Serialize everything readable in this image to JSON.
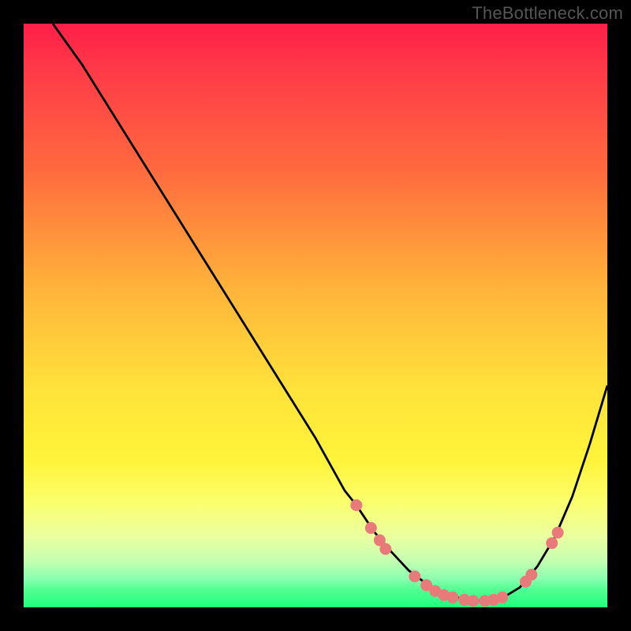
{
  "watermark": "TheBottleneck.com",
  "colors": {
    "background": "#000000",
    "gradient_top": "#ff1e48",
    "gradient_mid1": "#ff6a3e",
    "gradient_mid2": "#ffe33a",
    "gradient_bottom": "#1fff7c",
    "curve_stroke": "#000000",
    "dot_fill": "#e97a7a",
    "watermark_text": "#555555"
  },
  "chart_data": {
    "type": "line",
    "title": "",
    "xlabel": "",
    "ylabel": "",
    "xlim": [
      0,
      100
    ],
    "ylim": [
      0,
      100
    ],
    "grid": false,
    "legend": false,
    "series": [
      {
        "name": "curve",
        "x": [
          5,
          10,
          15,
          20,
          25,
          30,
          35,
          40,
          45,
          50,
          55,
          57,
          60,
          63,
          66,
          70,
          73,
          76,
          79,
          82,
          85,
          88,
          91,
          94,
          97,
          100
        ],
        "values": [
          100,
          93,
          85,
          77,
          69,
          61,
          53,
          45,
          37,
          29,
          20,
          17.5,
          13,
          9.5,
          6.3,
          3.3,
          2.0,
          1.3,
          1.1,
          1.6,
          3.4,
          7.0,
          12.0,
          19.0,
          28.0,
          38.0
        ]
      }
    ],
    "markers": [
      {
        "x": 57.0,
        "y": 17.5
      },
      {
        "x": 59.5,
        "y": 13.6
      },
      {
        "x": 61.0,
        "y": 11.5
      },
      {
        "x": 62.0,
        "y": 10.0
      },
      {
        "x": 67.0,
        "y": 5.3
      },
      {
        "x": 69.0,
        "y": 3.8
      },
      {
        "x": 70.5,
        "y": 2.8
      },
      {
        "x": 72.0,
        "y": 2.1
      },
      {
        "x": 73.5,
        "y": 1.7
      },
      {
        "x": 75.5,
        "y": 1.3
      },
      {
        "x": 77.0,
        "y": 1.1
      },
      {
        "x": 79.0,
        "y": 1.1
      },
      {
        "x": 80.5,
        "y": 1.3
      },
      {
        "x": 82.0,
        "y": 1.7
      },
      {
        "x": 86.0,
        "y": 4.4
      },
      {
        "x": 87.0,
        "y": 5.6
      },
      {
        "x": 90.5,
        "y": 11.0
      },
      {
        "x": 91.5,
        "y": 12.8
      }
    ]
  }
}
